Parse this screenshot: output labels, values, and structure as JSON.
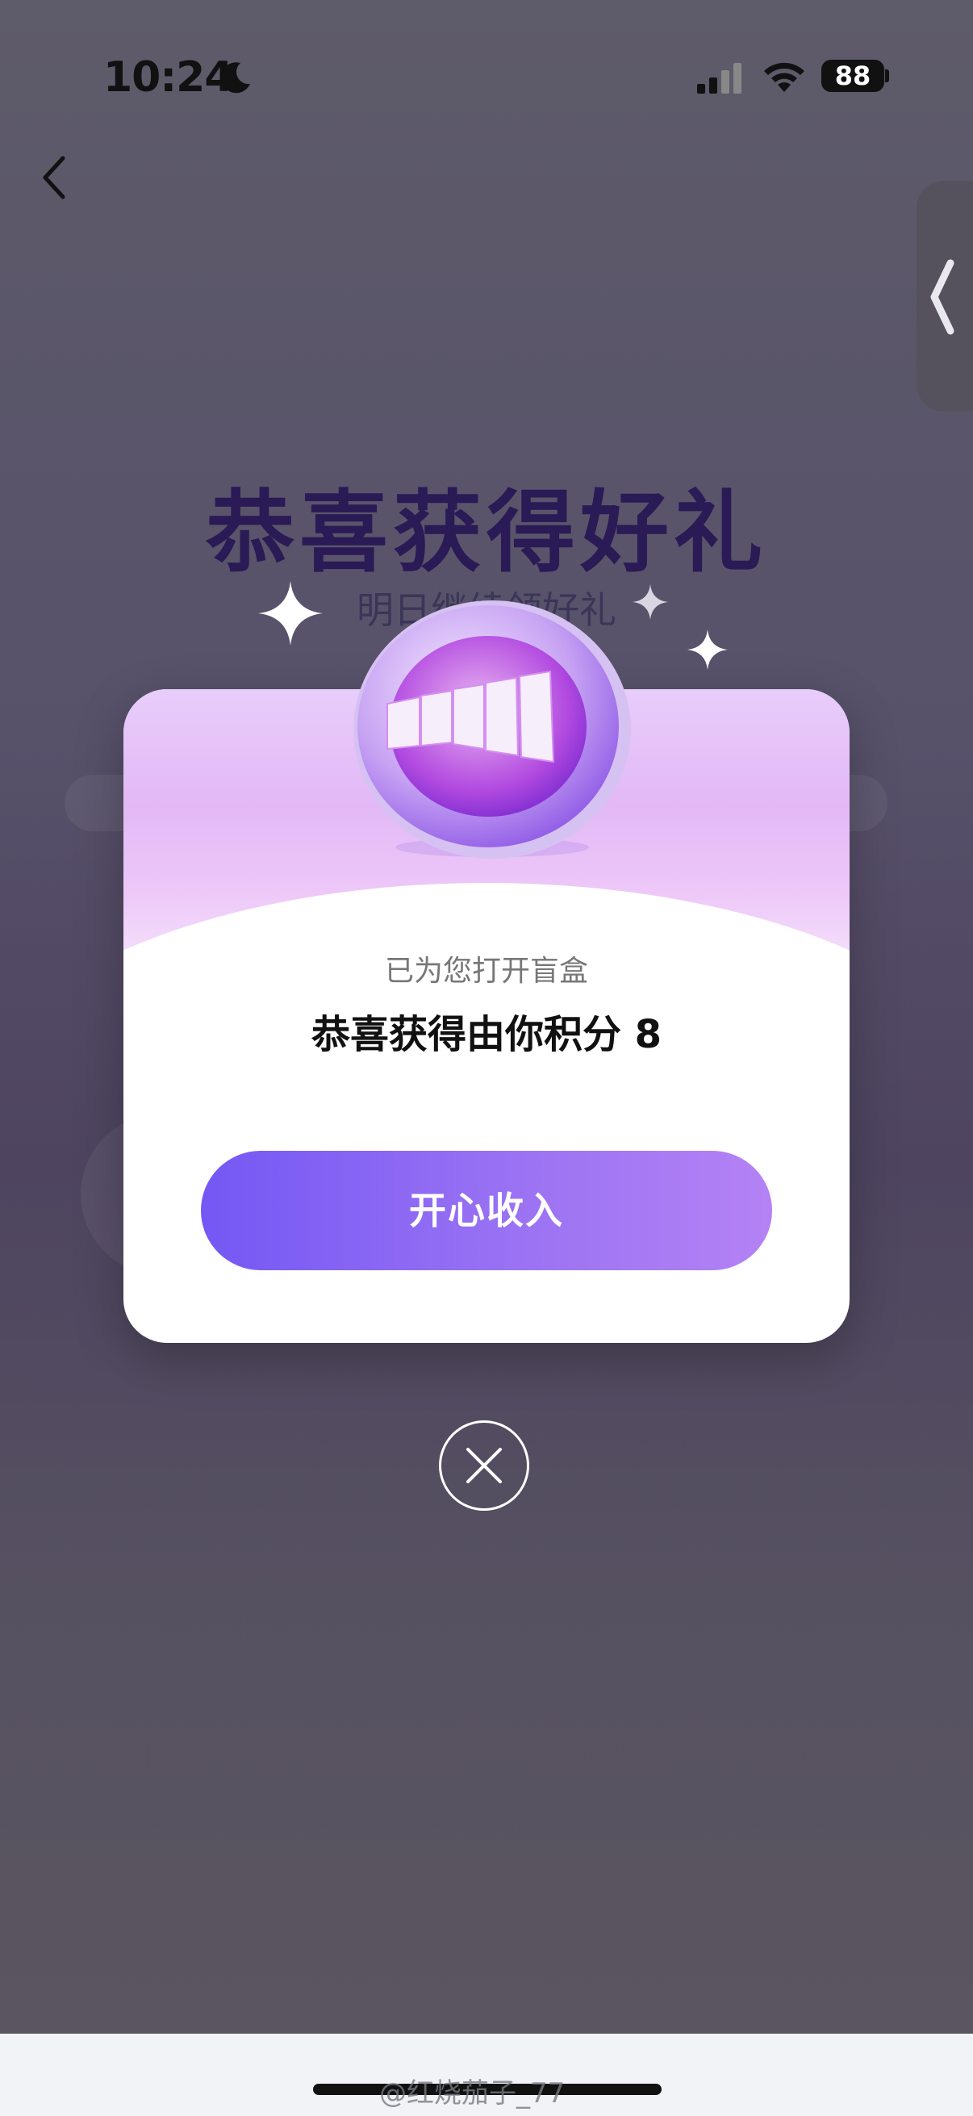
{
  "status_bar": {
    "time": "10:24",
    "battery": "88",
    "icons": [
      "moon-icon",
      "signal-icon",
      "wifi-icon",
      "battery-icon"
    ]
  },
  "nav": {
    "back_icon": "chevron-left-icon",
    "side_icon": "chevron-left-icon"
  },
  "background": {
    "title": "恭喜获得好礼",
    "subtitle": "明日继续领好礼"
  },
  "modal": {
    "subtitle": "已为您打开盲盒",
    "message": "恭喜获得由你积分 8",
    "confirm_label": "开心收入",
    "coin_icon": "points-coin-icon",
    "close_icon": "close-icon"
  },
  "watermark": "@红烧茄子_77",
  "colors": {
    "accent_start": "#7458f4",
    "accent_end": "#b482f4",
    "title": "#2a1a55"
  }
}
